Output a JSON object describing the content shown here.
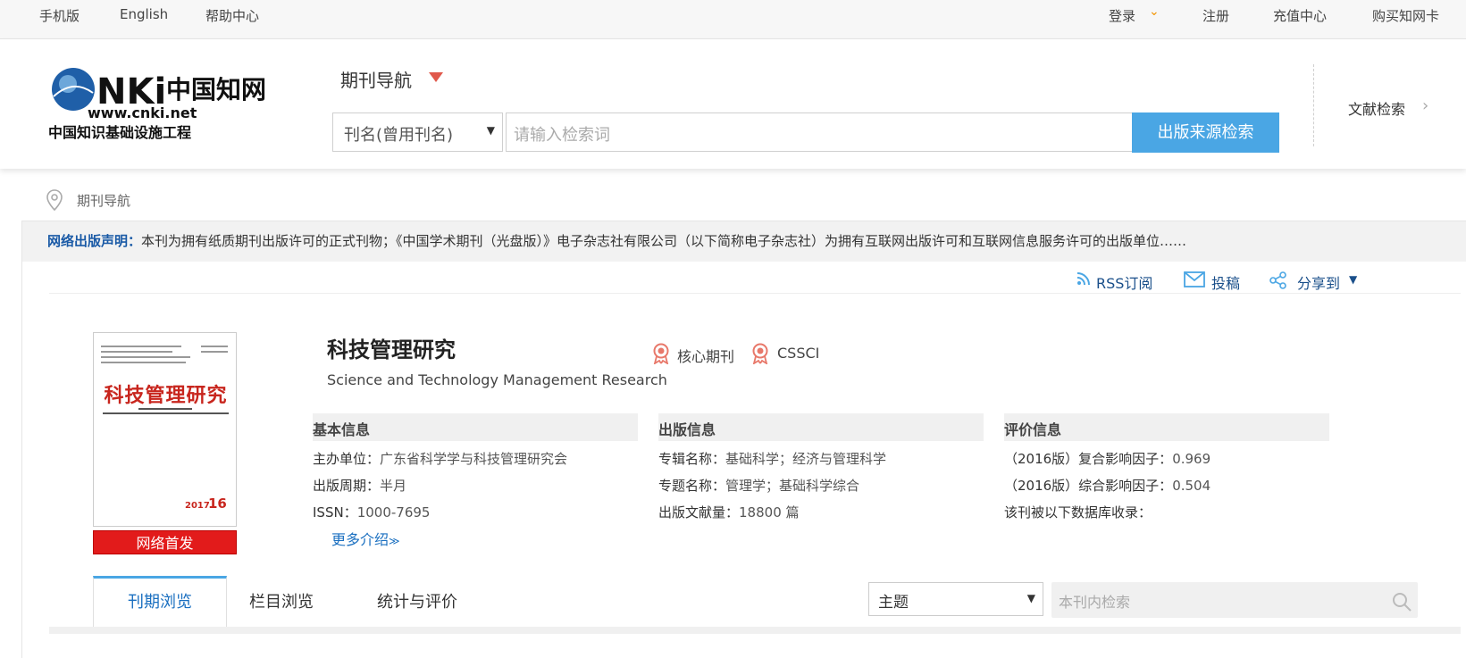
{
  "topbar": {
    "mobile": "手机版",
    "english": "English",
    "help": "帮助中心",
    "login": "登录",
    "register": "注册",
    "recharge": "充值中心",
    "buy_card": "购买知网卡"
  },
  "logo": {
    "cn_name": "中国知网",
    "url": "www.cnki.net",
    "project": "中国知识基础设施工程"
  },
  "header": {
    "nav_title": "期刊导航",
    "search_field": "刊名(曾用刊名)",
    "search_placeholder": "请输入检索词",
    "search_button": "出版来源检索",
    "literature_search": "文献检索"
  },
  "breadcrumb": "期刊导航",
  "notice": {
    "label": "网络出版声明：",
    "text": "本刊为拥有纸质期刊出版许可的正式刊物；《中国学术期刊（光盘版）》电子杂志社有限公司（以下简称电子杂志社）为拥有互联网出版许可和互联网信息服务许可的出版单位……"
  },
  "actions": {
    "rss": "RSS订阅",
    "submit": "投稿",
    "share": "分享到"
  },
  "journal": {
    "title": "科技管理研究",
    "english_title": "Science and Technology Management Research",
    "badges": [
      "核心期刊",
      "CSSCI"
    ],
    "cover": {
      "title": "科技管理研究",
      "year": "2017",
      "issue": "16",
      "network_first": "网络首发"
    }
  },
  "sections": {
    "basic": {
      "heading": "基本信息",
      "rows": [
        {
          "label": "主办单位：",
          "value": "广东省科学学与科技管理研究会"
        },
        {
          "label": "出版周期：",
          "value": "半月"
        },
        {
          "label": "ISSN：",
          "value": "1000-7695"
        }
      ],
      "more": "更多介绍"
    },
    "publication": {
      "heading": "出版信息",
      "rows": [
        {
          "label": "专辑名称：",
          "value": "基础科学；经济与管理科学"
        },
        {
          "label": "专题名称：",
          "value": "管理学；基础科学综合"
        },
        {
          "label": "出版文献量：",
          "value": "18800 篇"
        }
      ]
    },
    "evaluation": {
      "heading": "评价信息",
      "rows": [
        {
          "label": "（2016版）复合影响因子：",
          "value": "0.969"
        },
        {
          "label": "（2016版）综合影响因子：",
          "value": "0.504"
        },
        {
          "label": "该刊被以下数据库收录：",
          "value": ""
        }
      ]
    }
  },
  "tabs": [
    "刊期浏览",
    "栏目浏览",
    "统计与评价"
  ],
  "in_journal": {
    "field": "主题",
    "placeholder": "本刊内检索"
  },
  "colors": {
    "accent_blue": "#4aa6e4",
    "link_blue": "#1a4f8a",
    "cover_red": "#c8261e",
    "badge_red": "#e21b1b",
    "nav_triangle": "#e0584b",
    "login_chevron": "#f29400"
  }
}
